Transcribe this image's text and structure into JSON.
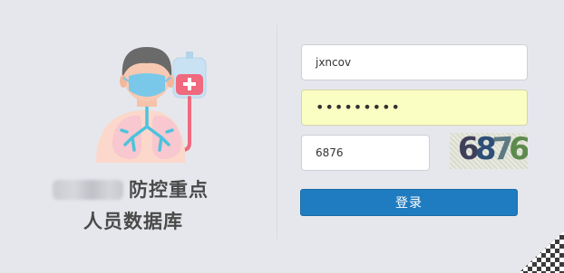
{
  "branding": {
    "title_line1": "防控重点",
    "title_line2": "人员数据库"
  },
  "login_form": {
    "username_value": "jxncov",
    "password_masked": "•••••••••",
    "captcha_input_value": "6876",
    "captcha_image_text": [
      "6",
      "8",
      "7",
      "6"
    ],
    "submit_label": "登录"
  },
  "colors": {
    "background": "#e6e7ec",
    "button": "#1f7cc1",
    "password_autofill": "#fafec2"
  }
}
